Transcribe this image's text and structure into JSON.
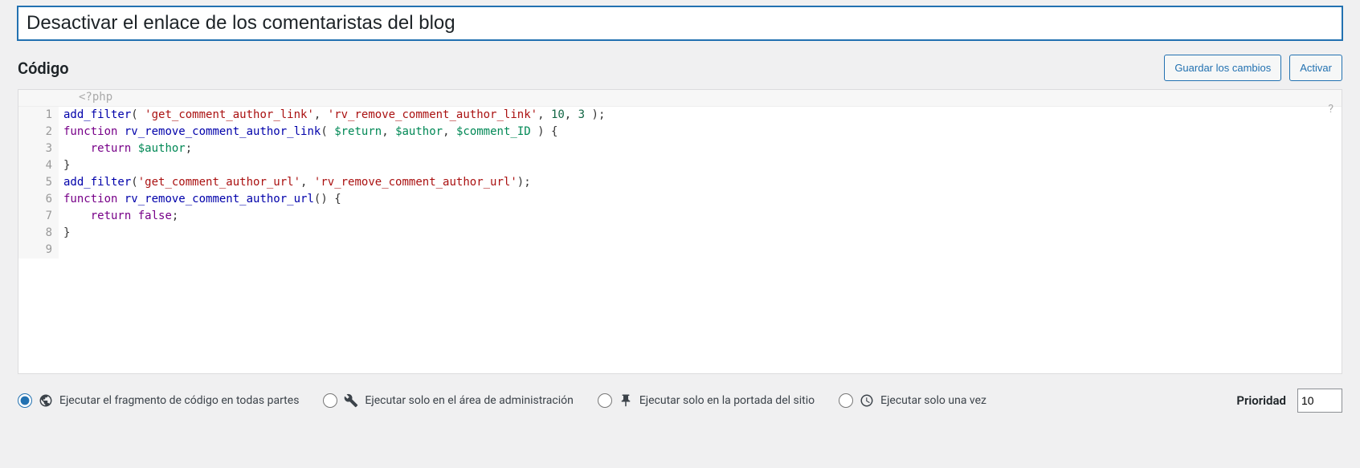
{
  "title_value": "Desactivar el enlace de los comentaristas del blog",
  "section": {
    "code_label": "Código"
  },
  "actions": {
    "save": "Guardar los cambios",
    "activate": "Activar"
  },
  "editor": {
    "placeholder": "<?php",
    "help": "?",
    "line_count": 9,
    "code": "add_filter( 'get_comment_author_link', 'rv_remove_comment_author_link', 10, 3 );\nfunction rv_remove_comment_author_link( $return, $author, $comment_ID ) {\n    return $author;\n}\nadd_filter('get_comment_author_url', 'rv_remove_comment_author_url');\nfunction rv_remove_comment_author_url() {\n    return false;\n}\n"
  },
  "scope": {
    "selected": "everywhere",
    "options": {
      "everywhere": "Ejecutar el fragmento de código en todas partes",
      "admin": "Ejecutar solo en el área de administración",
      "frontend": "Ejecutar solo en la portada del sitio",
      "once": "Ejecutar solo una vez"
    }
  },
  "priority": {
    "label": "Prioridad",
    "value": "10"
  }
}
